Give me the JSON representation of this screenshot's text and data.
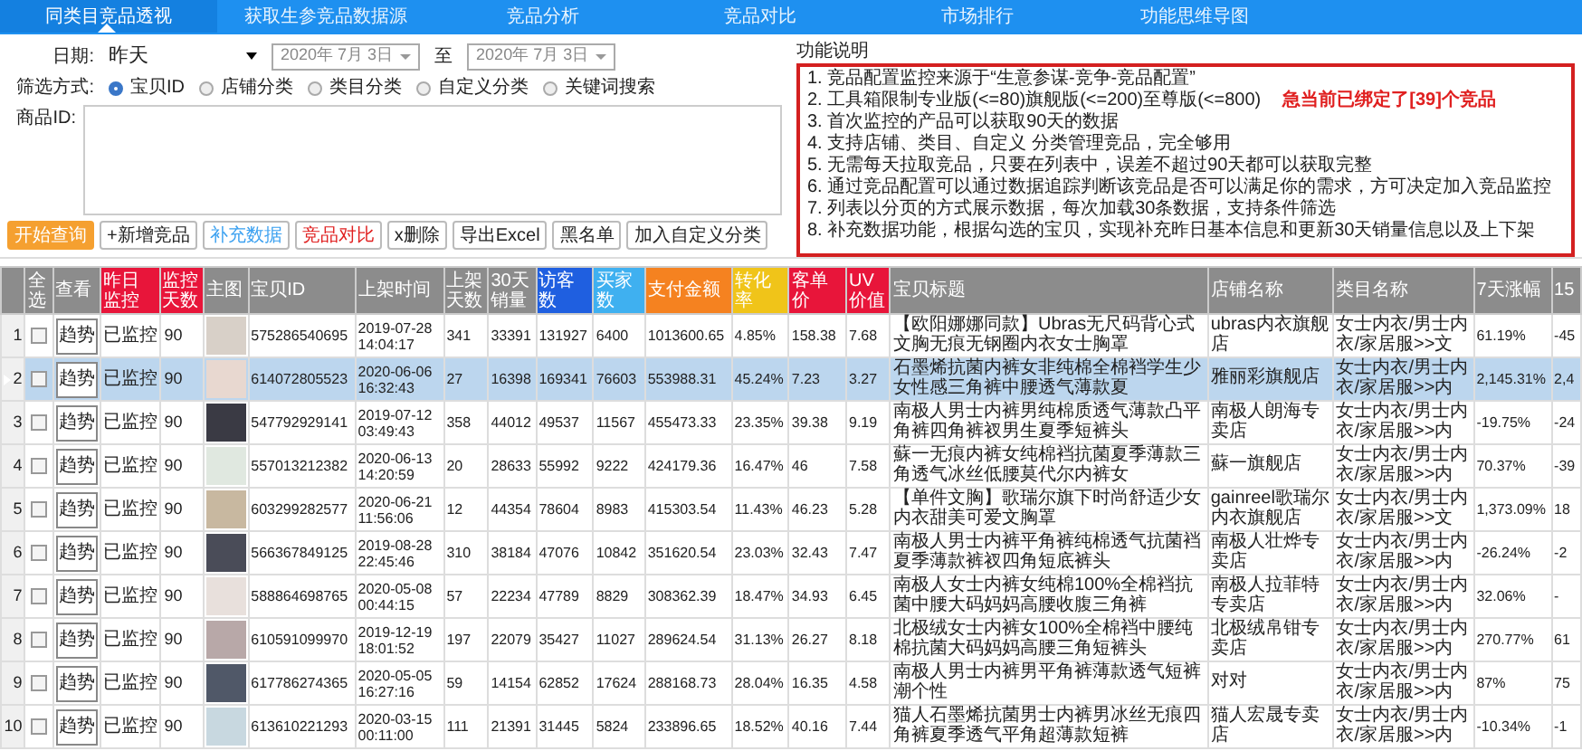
{
  "tabs": [
    {
      "label": "同类目竞品透视",
      "selected": true
    },
    {
      "label": "获取生参竞品数据源",
      "selected": false
    },
    {
      "label": "竞品分析",
      "selected": false
    },
    {
      "label": "竞品对比",
      "selected": false
    },
    {
      "label": "市场排行",
      "selected": false
    },
    {
      "label": "功能思维导图",
      "selected": false
    }
  ],
  "filter": {
    "date_label": "日期:",
    "date_value": "昨天",
    "from": "2020年 7月 3日",
    "to_label": "至",
    "to": "2020年 7月 3日",
    "mode_label": "筛选方式:",
    "modes": [
      {
        "label": "宝贝ID",
        "selected": true
      },
      {
        "label": "店铺分类",
        "selected": false
      },
      {
        "label": "类目分类",
        "selected": false
      },
      {
        "label": "自定义分类",
        "selected": false
      },
      {
        "label": "关键词搜索",
        "selected": false
      }
    ],
    "id_label": "商品ID:"
  },
  "buttons": [
    {
      "label": "开始查询",
      "kind": "primary"
    },
    {
      "label": "+新增竞品",
      "kind": "default"
    },
    {
      "label": "补充数据",
      "kind": "info"
    },
    {
      "label": "竞品对比",
      "kind": "danger"
    },
    {
      "label": "x删除",
      "kind": "default"
    },
    {
      "label": "导出Excel",
      "kind": "default"
    },
    {
      "label": "黑名单",
      "kind": "default"
    },
    {
      "label": "加入自定义分类",
      "kind": "default"
    }
  ],
  "notes": {
    "title": "功能说明",
    "lines": [
      "1. 竞品配置监控来源于“生意参谋-竞争-竞品配置”",
      "2. 工具箱限制专业版(<=80)旗舰版(<=200)至尊版(<=800)",
      "3. 首次监控的产品可以获取90天的数据",
      "4. 支持店铺、类目、自定义 分类管理竞品，完全够用",
      "5. 无需每天拉取竞品，只要在列表中，误差不超过90天都可以获取完整",
      "6. 通过竞品配置可以通过数据追踪判断该竞品是否可以满足你的需求，方可决定加入竞品监控",
      "7. 列表以分页的方式展示数据，每次加载30条数据，支持条件筛选",
      "8. 补充数据功能，根据勾选的宝贝，实现补充昨日基本信息和更新30天销量信息以及上下架"
    ],
    "alert": "急当前已绑定了[39]个竞品"
  },
  "table": {
    "columns": [
      {
        "label": "全选",
        "color": "#8c8c8c"
      },
      {
        "label": "查看",
        "color": "#8c8c8c"
      },
      {
        "label": "昨日监控",
        "color": "#e8153a"
      },
      {
        "label": "监控天数",
        "color": "#e8153a"
      },
      {
        "label": "主图",
        "color": "#8c8c8c"
      },
      {
        "label": "宝贝ID",
        "color": "#8c8c8c"
      },
      {
        "label": "上架时间",
        "color": "#8c8c8c"
      },
      {
        "label": "上架天数",
        "color": "#8c8c8c"
      },
      {
        "label": "30天销量",
        "color": "#8c8c8c"
      },
      {
        "label": "访客数",
        "color": "#1f5fe0"
      },
      {
        "label": "买家数",
        "color": "#3fb0f0"
      },
      {
        "label": "支付金额",
        "color": "#f58220"
      },
      {
        "label": "转化率",
        "color": "#f0c419"
      },
      {
        "label": "客单价",
        "color": "#e8153a"
      },
      {
        "label": "UV价值",
        "color": "#e8153a"
      },
      {
        "label": "宝贝标题",
        "color": "#8c8c8c"
      },
      {
        "label": "店铺名称",
        "color": "#8c8c8c"
      },
      {
        "label": "类目名称",
        "color": "#8c8c8c"
      },
      {
        "label": "7天涨幅",
        "color": "#8c8c8c"
      },
      {
        "label": "15",
        "color": "#8c8c8c"
      }
    ],
    "rows": [
      {
        "number": "1",
        "selected": false,
        "checked": false,
        "action": "趋势",
        "monitor": "已监控",
        "days": "90",
        "id": "575286540695",
        "listed": "2019-07-28 14:04:17",
        "listed_days": "341",
        "sales_30d": "33391",
        "visitors": "131927",
        "buyers": "6400",
        "payment": "1013600.65",
        "conversion": "4.85%",
        "order_value": "158.38",
        "uv_value": "7.68",
        "title": "【欧阳娜娜同款】Ubras无尺码背心式文胸无痕无钢圈内衣女士胸罩",
        "shop": "ubras内衣旗舰店",
        "category": "女士内衣/男士内衣/家居服>>文",
        "change_7d": "61.19%",
        "change_15d": "-45"
      },
      {
        "number": "2",
        "selected": true,
        "checked": false,
        "action": "趋势",
        "monitor": "已监控",
        "days": "90",
        "id": "614072805523",
        "listed": "2020-06-06 16:32:43",
        "listed_days": "27",
        "sales_30d": "16398",
        "visitors": "169341",
        "buyers": "76603",
        "payment": "553988.31",
        "conversion": "45.24%",
        "order_value": "7.23",
        "uv_value": "3.27",
        "title": "石墨烯抗菌内裤女非纯棉全棉裆学生少女性感三角裤中腰透气薄款夏",
        "shop": "雅丽彩旗舰店",
        "category": "女士内衣/男士内衣/家居服>>内",
        "change_7d": "2,145.31%",
        "change_15d": "2,4"
      },
      {
        "number": "3",
        "selected": false,
        "checked": false,
        "action": "趋势",
        "monitor": "已监控",
        "days": "90",
        "id": "547792929141",
        "listed": "2019-07-12 03:49:43",
        "listed_days": "358",
        "sales_30d": "44012",
        "visitors": "49537",
        "buyers": "11567",
        "payment": "455473.33",
        "conversion": "23.35%",
        "order_value": "39.38",
        "uv_value": "9.19",
        "title": "南极人男士内裤男纯棉质透气薄款凸平角裤四角裤衩男生夏季短裤头",
        "shop": "南极人朗海专卖店",
        "category": "女士内衣/男士内衣/家居服>>内",
        "change_7d": "-19.75%",
        "change_15d": "-24"
      },
      {
        "number": "4",
        "selected": false,
        "checked": false,
        "action": "趋势",
        "monitor": "已监控",
        "days": "90",
        "id": "557013212382",
        "listed": "2020-06-13 14:20:59",
        "listed_days": "20",
        "sales_30d": "28633",
        "visitors": "55992",
        "buyers": "9222",
        "payment": "424179.36",
        "conversion": "16.47%",
        "order_value": "46",
        "uv_value": "7.58",
        "title": "蘇一无痕内裤女纯棉裆抗菌夏季薄款三角透气冰丝低腰莫代尔内裤女",
        "shop": "蘇一旗舰店",
        "category": "女士内衣/男士内衣/家居服>>内",
        "change_7d": "70.37%",
        "change_15d": "-39"
      },
      {
        "number": "5",
        "selected": false,
        "checked": false,
        "action": "趋势",
        "monitor": "已监控",
        "days": "90",
        "id": "603299282577",
        "listed": "2020-06-21 11:56:06",
        "listed_days": "12",
        "sales_30d": "44354",
        "visitors": "78604",
        "buyers": "8983",
        "payment": "415303.54",
        "conversion": "11.43%",
        "order_value": "46.23",
        "uv_value": "5.28",
        "title": "【单件文胸】歌瑞尔旗下时尚舒适少女内衣甜美可爱文胸罩",
        "shop": "gainreel歌瑞尔内衣旗舰店",
        "category": "女士内衣/男士内衣/家居服>>文",
        "change_7d": "1,373.09%",
        "change_15d": "18"
      },
      {
        "number": "6",
        "selected": false,
        "checked": false,
        "action": "趋势",
        "monitor": "已监控",
        "days": "90",
        "id": "566367849125",
        "listed": "2019-08-28 22:45:46",
        "listed_days": "310",
        "sales_30d": "38184",
        "visitors": "47076",
        "buyers": "10842",
        "payment": "351620.54",
        "conversion": "23.03%",
        "order_value": "32.43",
        "uv_value": "7.47",
        "title": "南极人男士内裤平角裤纯棉透气抗菌裆夏季薄款裤衩四角短底裤头",
        "shop": "南极人壮烨专卖店",
        "category": "女士内衣/男士内衣/家居服>>内",
        "change_7d": "-26.24%",
        "change_15d": "-2"
      },
      {
        "number": "7",
        "selected": false,
        "checked": false,
        "action": "趋势",
        "monitor": "已监控",
        "days": "90",
        "id": "588864698765",
        "listed": "2020-05-08 00:44:15",
        "listed_days": "57",
        "sales_30d": "22234",
        "visitors": "47789",
        "buyers": "8829",
        "payment": "308362.39",
        "conversion": "18.47%",
        "order_value": "34.93",
        "uv_value": "6.45",
        "title": "南极人女士内裤女纯棉100%全棉裆抗菌中腰大码妈妈高腰收腹三角裤",
        "shop": "南极人拉菲特专卖店",
        "category": "女士内衣/男士内衣/家居服>>内",
        "change_7d": "32.06%",
        "change_15d": "-"
      },
      {
        "number": "8",
        "selected": false,
        "checked": false,
        "action": "趋势",
        "monitor": "已监控",
        "days": "90",
        "id": "610591099970",
        "listed": "2019-12-19 18:01:52",
        "listed_days": "197",
        "sales_30d": "22079",
        "visitors": "35427",
        "buyers": "11027",
        "payment": "289624.54",
        "conversion": "31.13%",
        "order_value": "26.27",
        "uv_value": "8.18",
        "title": "北极绒女士内裤女100%全棉裆中腰纯棉抗菌大码妈妈高腰三角短裤头",
        "shop": "北极绒帛钳专卖店",
        "category": "女士内衣/男士内衣/家居服>>内",
        "change_7d": "270.77%",
        "change_15d": "61"
      },
      {
        "number": "9",
        "selected": false,
        "checked": false,
        "action": "趋势",
        "monitor": "已监控",
        "days": "90",
        "id": "617786274365",
        "listed": "2020-05-05 16:27:16",
        "listed_days": "59",
        "sales_30d": "14154",
        "visitors": "62852",
        "buyers": "17624",
        "payment": "288168.73",
        "conversion": "28.04%",
        "order_value": "16.35",
        "uv_value": "4.58",
        "title": "南极人男士内裤男平角裤薄款透气短裤潮个性",
        "shop": "对对",
        "category": "女士内衣/男士内衣/家居服>>内",
        "change_7d": "87%",
        "change_15d": "75"
      },
      {
        "number": "10",
        "selected": false,
        "checked": false,
        "action": "趋势",
        "monitor": "已监控",
        "days": "90",
        "id": "613610221293",
        "listed": "2020-03-15 00:11:00",
        "listed_days": "111",
        "sales_30d": "21391",
        "visitors": "31445",
        "buyers": "5824",
        "payment": "233896.65",
        "conversion": "18.52%",
        "order_value": "40.16",
        "uv_value": "7.44",
        "title": "猫人石墨烯抗菌男士内裤男冰丝无痕四角裤夏季透气平角超薄款短裤",
        "shop": "猫人宏晟专卖店",
        "category": "女士内衣/男士内衣/家居服>>内",
        "change_7d": "-10.34%",
        "change_15d": "-1"
      }
    ]
  }
}
